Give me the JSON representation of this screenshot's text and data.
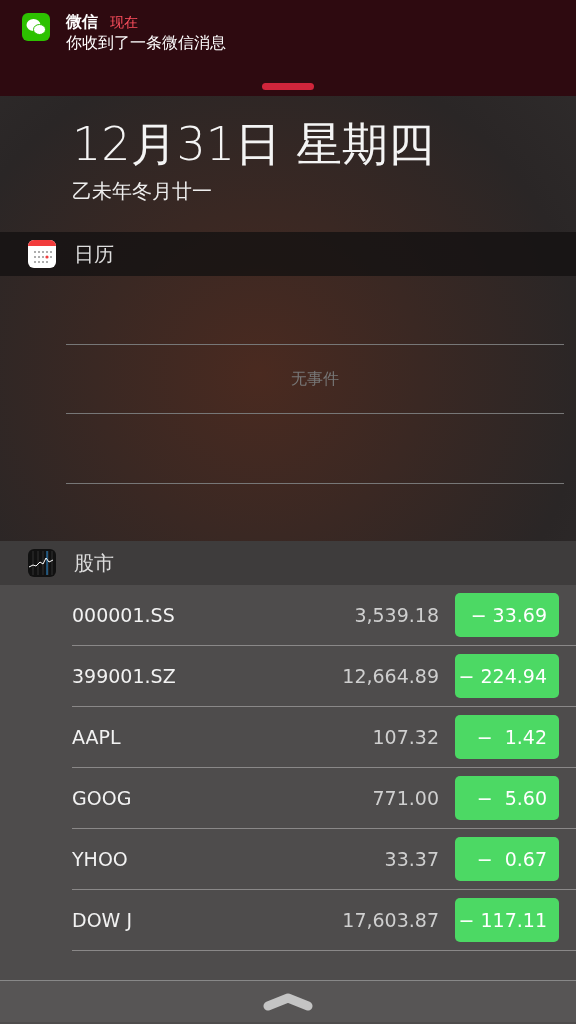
{
  "notification": {
    "app": "微信",
    "time": "现在",
    "message": "你收到了一条微信消息"
  },
  "date": {
    "title": "12月31日 星期四",
    "lunar": "乙未年冬月廿一"
  },
  "calendar": {
    "title": "日历",
    "empty": "无事件"
  },
  "stocks": {
    "title": "股市",
    "rows": [
      {
        "symbol": "000001.SS",
        "price": "3,539.18",
        "change": "− 33.69",
        "color": "#4cd964"
      },
      {
        "symbol": "399001.SZ",
        "price": "12,664.89",
        "change": "− 224.94",
        "color": "#4cd964"
      },
      {
        "symbol": "AAPL",
        "price": "107.32",
        "change": "−  1.42",
        "color": "#4cd964"
      },
      {
        "symbol": "GOOG",
        "price": "771.00",
        "change": "−  5.60",
        "color": "#4cd964"
      },
      {
        "symbol": "YHOO",
        "price": "33.37",
        "change": "−  0.67",
        "color": "#4cd964"
      },
      {
        "symbol": "DOW J",
        "price": "17,603.87",
        "change": "− 117.11",
        "color": "#4cd964"
      }
    ]
  }
}
